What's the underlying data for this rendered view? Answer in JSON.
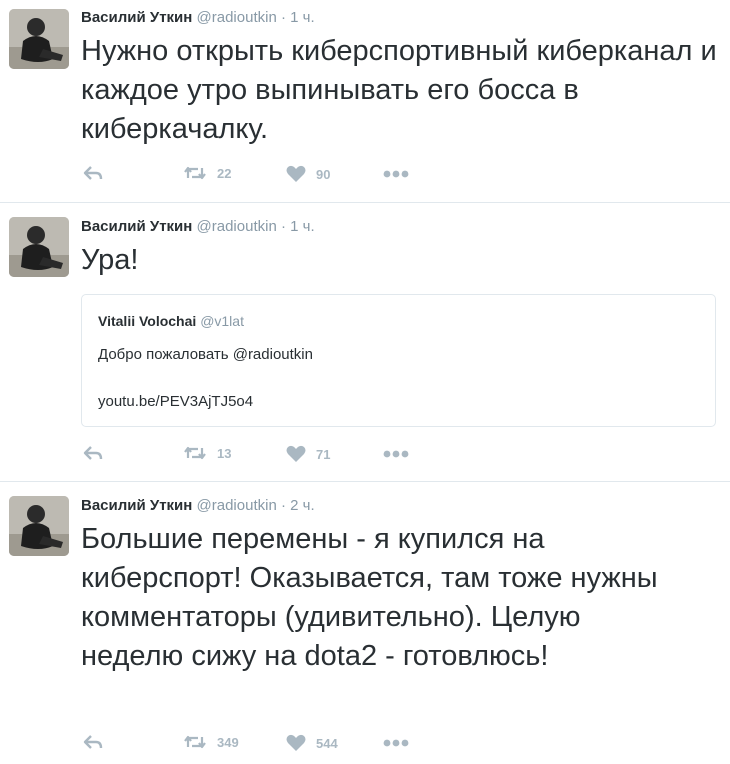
{
  "tweets": [
    {
      "name": "Василий Уткин",
      "handle": "@radioutkin",
      "dot": "·",
      "time": "1 ч.",
      "text": "Нужно открыть киберспортивный киберканал и каждое утро выпинывать его босса в киберкачалку.",
      "retweets": "22",
      "likes": "90"
    },
    {
      "name": "Василий Уткин",
      "handle": "@radioutkin",
      "dot": "·",
      "time": "1 ч.",
      "text": "Ура!",
      "retweets": "13",
      "likes": "71",
      "quote": {
        "name": "Vitalii Volochai",
        "handle": "@v1lat",
        "line1": "Добро пожаловать @radioutkin",
        "line2": "youtu.be/PEV3AjTJ5o4"
      }
    },
    {
      "name": "Василий Уткин",
      "handle": "@radioutkin",
      "dot": "·",
      "time": "2 ч.",
      "text": "Большие перемены - я купился на киберспорт! Оказывается, там тоже нужны комментаторы (удивительно). Целую неделю сижу на dota2 - готовлюсь!",
      "retweets": "349",
      "likes": "544"
    }
  ],
  "icons": {
    "reply": "reply-icon",
    "retweet": "retweet-icon",
    "like": "heart-icon",
    "more": "more-icon"
  },
  "colors": {
    "text": "#292f33",
    "muted": "#8899a6",
    "action": "#aab8c2",
    "border": "#e1e8ed"
  }
}
